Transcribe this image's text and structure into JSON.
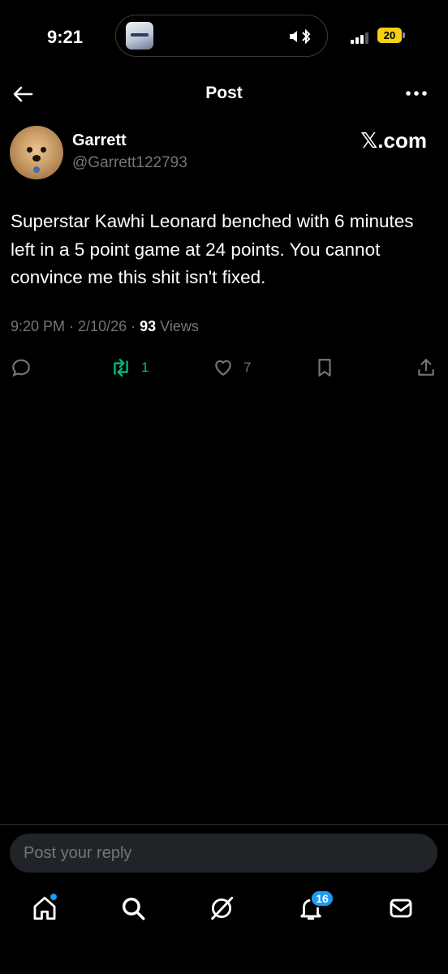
{
  "status_bar": {
    "time": "9:21",
    "battery": "20"
  },
  "header": {
    "title": "Post"
  },
  "author": {
    "name": "Garrett",
    "handle": "@Garrett122793",
    "source": "𝕏.com"
  },
  "post": {
    "text": "Superstar Kawhi Leonard benched with 6 minutes left in a 5 point game at 24 points. You cannot convince me this shit isn't fixed.",
    "time": "9:20 PM",
    "sep1": " · ",
    "date": "2/10/26",
    "sep2": " · ",
    "views_count": "93",
    "views_label": " Views"
  },
  "actions": {
    "reply_icon": "reply-icon",
    "reposts": "1",
    "likes": "7",
    "bookmark_icon": "bookmark-icon",
    "share_icon": "share-icon"
  },
  "reply": {
    "placeholder": "Post your reply"
  },
  "tabbar": {
    "icons": [
      "home-icon",
      "search-icon",
      "grok-icon",
      "notifications-icon",
      "messages-icon"
    ],
    "notifications_badge": "16"
  },
  "colors": {
    "background": "#000000",
    "text": "#e7e9ea",
    "muted": "#71767b",
    "repost": "#00ba7c",
    "accent": "#1d9bf0",
    "battery": "#f5cf14"
  }
}
